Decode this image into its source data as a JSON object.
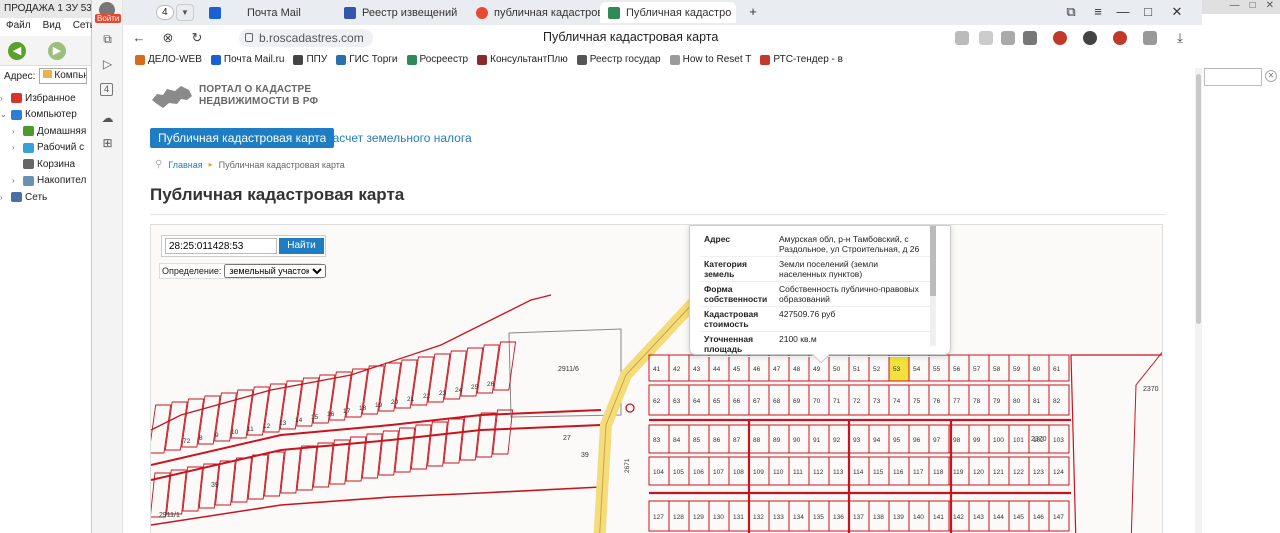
{
  "explorer": {
    "title": "ПРОДАЖА 1 ЗУ 53 (",
    "menu": [
      "Файл",
      "Вид",
      "Сеть"
    ],
    "address_label": "Адрес:",
    "address_value": "Компью",
    "tree": [
      {
        "label": "Избранное",
        "icon": "heart-icon",
        "color": "#d9342b",
        "level": 0
      },
      {
        "label": "Компьютер",
        "icon": "computer-icon",
        "color": "#2a7fd4",
        "level": 0
      },
      {
        "label": "Домашняя",
        "icon": "home-icon",
        "color": "#4c9a2a",
        "level": 1
      },
      {
        "label": "Рабочий с",
        "icon": "desktop-icon",
        "color": "#3aa0d8",
        "level": 1
      },
      {
        "label": "Корзина",
        "icon": "trash-icon",
        "color": "#666666",
        "level": 1
      },
      {
        "label": "Накопител",
        "icon": "drive-icon",
        "color": "#6b8fb5",
        "level": 1
      },
      {
        "label": "Сеть",
        "icon": "network-icon",
        "color": "#4a6fa5",
        "level": 0
      }
    ]
  },
  "browser": {
    "sidebar": {
      "login_label": "Войти",
      "tab_badge": "4"
    },
    "tabs": [
      {
        "label": "Почта Mail",
        "icon": "mail-icon",
        "color": "#1a5fd6",
        "active": false
      },
      {
        "label": "Реестр извещений",
        "icon": "shield-icon",
        "color": "#3355aa",
        "active": false
      },
      {
        "label": "публичная кадастровая",
        "icon": "yandex-icon",
        "color": "#e84a2f",
        "active": false
      },
      {
        "label": "Публичная кадастро",
        "icon": "map-icon",
        "color": "#2e8b57",
        "active": true
      }
    ],
    "tab_count": "4",
    "url": "b.roscadastres.com",
    "page_title": "Публичная кадастровая карта",
    "bookmarks": [
      {
        "label": "ДЕЛО-WEB",
        "color": "#d96a1c"
      },
      {
        "label": "Почта Mail.ru",
        "color": "#1a5fd6"
      },
      {
        "label": "ППУ",
        "color": "#444444"
      },
      {
        "label": "ГИС Торги",
        "color": "#2a6fb0"
      },
      {
        "label": "Росреестр",
        "color": "#2e8b57"
      },
      {
        "label": "КонсультантПлю",
        "color": "#8a2a2a"
      },
      {
        "label": "Реестр государ",
        "color": "#555555"
      },
      {
        "label": "How to Reset T",
        "color": "#999999"
      },
      {
        "label": "РТС-тендер - в",
        "color": "#c0392b"
      }
    ]
  },
  "page": {
    "logo_line1": "ПОРТАЛ О КАДАСТРЕ",
    "logo_line2": "НЕДВИЖИМОСТИ В РФ",
    "nav_active": "Публичная кадастровая карта",
    "nav_link": "Расчет земельного налога",
    "breadcrumb_home": "Главная",
    "breadcrumb_current": "Публичная кадастровая карта",
    "heading": "Публичная кадастровая карта"
  },
  "map": {
    "search_value": "28:25:011428:53",
    "search_button": "Найти",
    "definition_label": "Определение:",
    "definition_value": "земельный участок",
    "info": [
      {
        "key": "Адрес",
        "value": "Амурская обл, р-н Тамбовский, с Раздольное, ул Строительная, д 26"
      },
      {
        "key": "Категория земель",
        "value": "Земли поселений (земли населенных пунктов)"
      },
      {
        "key": "Форма собственности",
        "value": "Собственность публично-правовых образований"
      },
      {
        "key": "Кадастровая стоимость",
        "value": "427509.76 руб"
      },
      {
        "key": "Уточненная площадь",
        "value": "2100 кв.м"
      }
    ],
    "labels": {
      "parcel_a": "2911/6",
      "parcel_b": "2911/1",
      "parcel_c": "2370",
      "parcel_d": "2370",
      "parcel_e": "2671",
      "parcel_f": "39",
      "parcel_g": "27",
      "parcel_h": "39"
    },
    "plot_numbers_row1": [
      "41",
      "42",
      "43",
      "44",
      "45",
      "46",
      "47",
      "48",
      "49",
      "50",
      "51",
      "52",
      "53",
      "54",
      "55",
      "56",
      "57",
      "58",
      "59",
      "60",
      "61"
    ],
    "plot_numbers_row2": [
      "62",
      "63",
      "64",
      "65",
      "66",
      "67",
      "68",
      "69",
      "70",
      "71",
      "72",
      "73",
      "74",
      "75",
      "76",
      "77",
      "78",
      "79",
      "80",
      "81",
      "82"
    ],
    "plot_numbers_row3": [
      "83",
      "84",
      "85",
      "86",
      "87",
      "88",
      "89",
      "90",
      "91",
      "92",
      "93",
      "94",
      "95",
      "96",
      "97",
      "98",
      "99",
      "100",
      "101",
      "102",
      "103"
    ],
    "plot_numbers_row4": [
      "104",
      "105",
      "106",
      "107",
      "108",
      "109",
      "110",
      "111",
      "112",
      "113",
      "114",
      "115",
      "116",
      "117",
      "118",
      "119",
      "120",
      "121",
      "122",
      "123",
      "124"
    ],
    "plot_numbers_row5": [
      "127",
      "128",
      "129",
      "130",
      "131",
      "132",
      "133",
      "134",
      "135",
      "136",
      "137",
      "138",
      "139",
      "140",
      "141",
      "142",
      "143",
      "144",
      "145",
      "146",
      "147"
    ],
    "left_numbers": [
      "72",
      "8",
      "9",
      "10",
      "11",
      "12",
      "13",
      "14",
      "15",
      "16",
      "17",
      "18",
      "19",
      "20",
      "21",
      "22",
      "23",
      "24",
      "25",
      "26"
    ],
    "highlight_plot": "53",
    "colors": {
      "parcel_line": "#c8141e",
      "highlight": "#f3e23a",
      "road": "#f5dc7a"
    }
  }
}
